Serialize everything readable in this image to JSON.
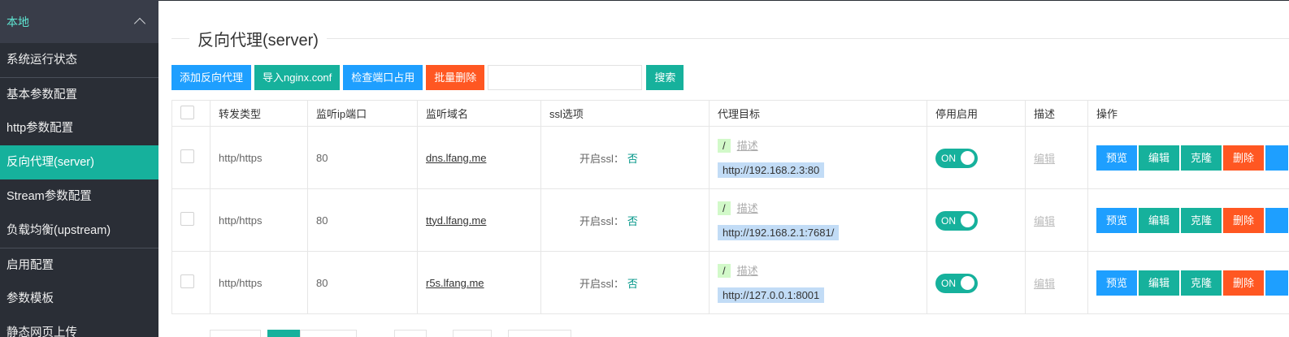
{
  "sidebar": {
    "group": "本地",
    "items": [
      {
        "label": "系统运行状态"
      },
      {
        "label": "基本参数配置"
      },
      {
        "label": "http参数配置"
      },
      {
        "label": "反向代理(server)"
      },
      {
        "label": "Stream参数配置"
      },
      {
        "label": "负载均衡(upstream)"
      },
      {
        "label": "启用配置"
      },
      {
        "label": "参数模板"
      },
      {
        "label": "静态网页上传"
      }
    ]
  },
  "page": {
    "title": "反向代理(server)"
  },
  "toolbar": {
    "add": "添加反向代理",
    "import": "导入nginx.conf",
    "check": "检查端口占用",
    "batch_delete": "批量删除",
    "search_value": "",
    "search": "搜索"
  },
  "table": {
    "headers": [
      "转发类型",
      "监听ip端口",
      "监听域名",
      "ssl选项",
      "代理目标",
      "停用启用",
      "描述",
      "操作"
    ],
    "rows": [
      {
        "type": "http/https",
        "port": "80",
        "domain": "dns.lfang.me",
        "ssl_label": "开启ssl：",
        "ssl_value": "否",
        "path": "/",
        "path_desc": "描述",
        "target": "http://192.168.2.3:80",
        "enabled": "ON",
        "desc": "编辑"
      },
      {
        "type": "http/https",
        "port": "80",
        "domain": "ttyd.lfang.me",
        "ssl_label": "开启ssl：",
        "ssl_value": "否",
        "path": "/",
        "path_desc": "描述",
        "target": "http://192.168.2.1:7681/",
        "enabled": "ON",
        "desc": "编辑"
      },
      {
        "type": "http/https",
        "port": "80",
        "domain": "r5s.lfang.me",
        "ssl_label": "开启ssl：",
        "ssl_value": "否",
        "path": "/",
        "path_desc": "描述",
        "target": "http://127.0.0.1:8001",
        "enabled": "ON",
        "desc": "编辑"
      }
    ],
    "ops": {
      "preview": "预览",
      "edit": "编辑",
      "clone": "克隆",
      "delete": "删除"
    }
  },
  "colors": {
    "accent": "#16b19c",
    "blue": "#1e9fff",
    "orange": "#ff5722",
    "sidebar_bg": "#2a2e36"
  }
}
